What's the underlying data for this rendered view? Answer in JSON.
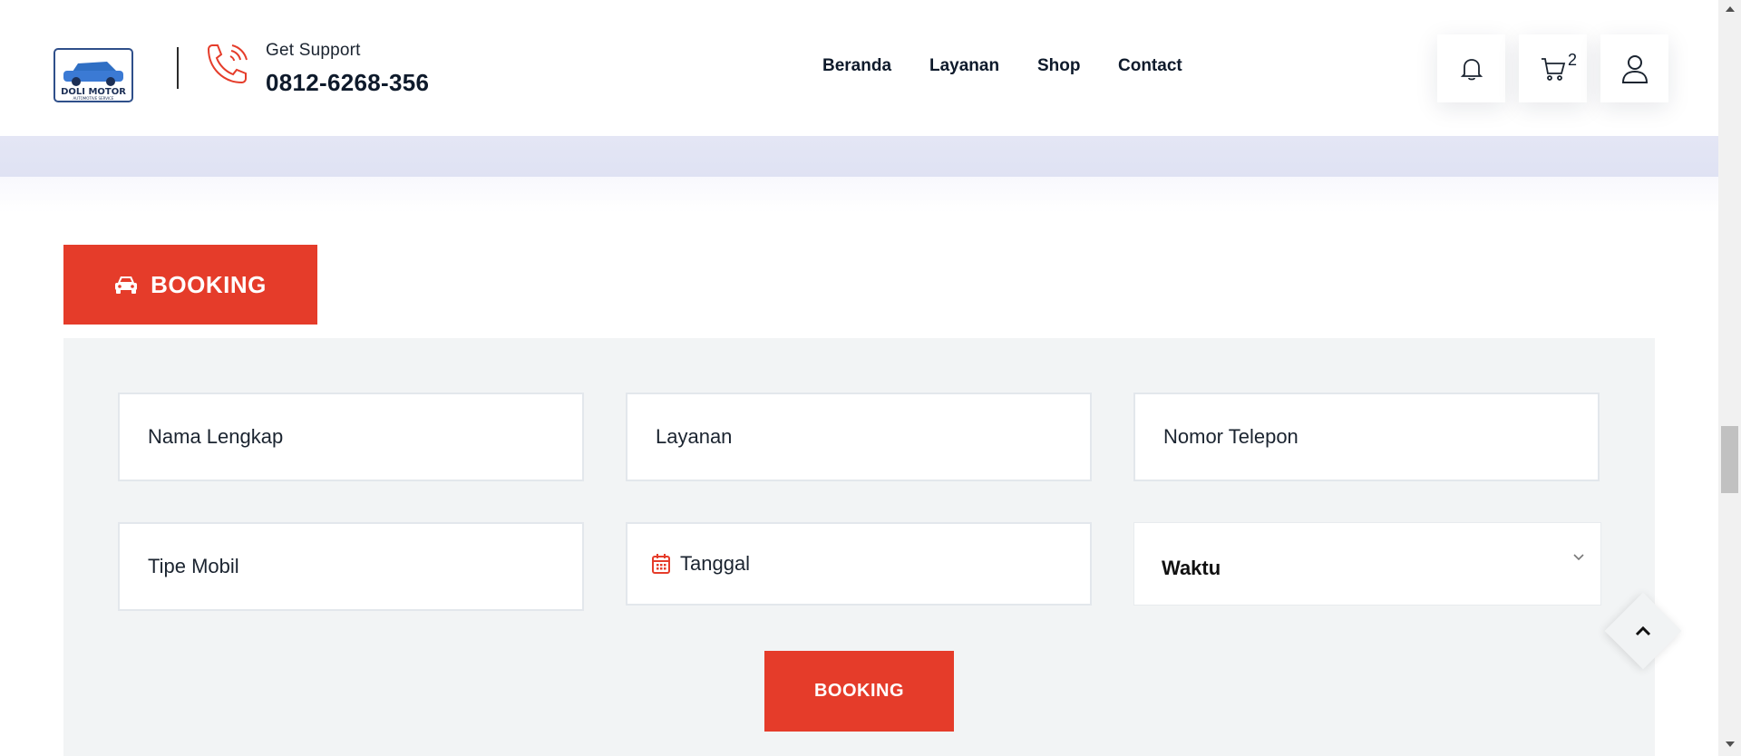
{
  "header": {
    "logo": {
      "text": "DOLI MOTOR",
      "subtext": "AUTOMOTIVE SERVICE"
    },
    "support": {
      "label": "Get Support",
      "phone": "0812-6268-356"
    },
    "nav": [
      "Beranda",
      "Layanan",
      "Shop",
      "Contact"
    ],
    "cart_count": "2",
    "icons": [
      "bell-icon",
      "cart-icon",
      "user-icon"
    ]
  },
  "booking": {
    "tab_label": "BOOKING",
    "fields": {
      "name": "Nama Lengkap",
      "service": "Layanan",
      "phone": "Nomor Telepon",
      "car_type": "Tipe Mobil",
      "date": "Tanggal",
      "time": "Waktu"
    },
    "submit_label": "BOOKING"
  },
  "colors": {
    "accent": "#e53c2a",
    "panel": "#f2f4f5",
    "band": "#e0e3f3",
    "text": "#0e1a2b"
  }
}
